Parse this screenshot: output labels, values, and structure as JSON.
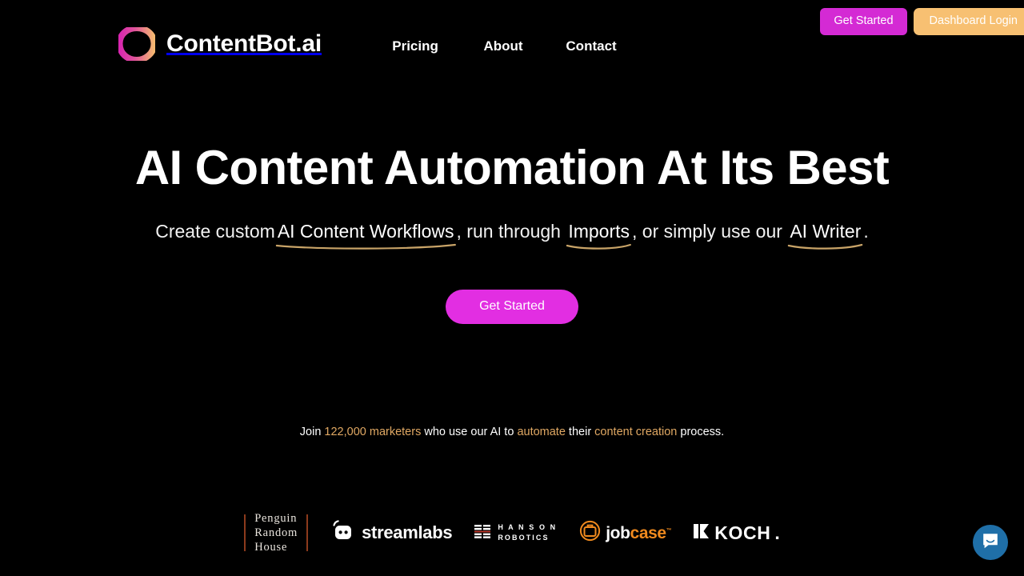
{
  "brand": {
    "name": "ContentBot.ai",
    "logo_icon": "gradient-ring-icon",
    "gradient_from": "#d926b0",
    "gradient_to": "#f5b870"
  },
  "nav": {
    "items": [
      {
        "label": "Pricing"
      },
      {
        "label": "About"
      },
      {
        "label": "Contact"
      }
    ]
  },
  "auth": {
    "get_started_label": "Get Started",
    "dashboard_login_label": "Dashboard Login",
    "get_started_color": "#d42ad4",
    "dashboard_login_color": "#f7c072"
  },
  "hero": {
    "title": "AI Content Automation At Its Best",
    "sub": {
      "part1": "Create custom",
      "hl1": "AI Content Workflows",
      "part2": ", run through ",
      "hl2": "Imports",
      "part3": ", or simply use our ",
      "hl3": "AI Writer",
      "part4": "."
    },
    "cta_label": "Get Started",
    "cta_color": "#e22ee2",
    "underline_color": "#c9a468"
  },
  "social_proof": {
    "part1": "Join ",
    "accent1": "122,000 marketers",
    "part2": " who use our AI to ",
    "accent2": "automate",
    "part3": " their ",
    "accent3": "content creation",
    "part4": " process.",
    "accent_color": "#e0a863"
  },
  "logos": {
    "penguin": {
      "line1": "Penguin",
      "line2": "Random",
      "line3": "House",
      "rule_color": "#8c3a1c"
    },
    "streamlabs": {
      "name": "streamlabs",
      "icon": "streamlabs-mascot-icon"
    },
    "hanson": {
      "line1": "H A N S O N",
      "line2": "ROBOTICS",
      "icon": "hanson-bars-icon"
    },
    "jobcase": {
      "part1": "job",
      "part2": "case",
      "tm": "™",
      "icon": "jobcase-briefcase-icon",
      "color": "#f08a1e"
    },
    "koch": {
      "name": "KOCH",
      "dot": ".",
      "icon": "koch-mark-icon"
    }
  },
  "chat": {
    "label": "Open chat",
    "icon": "chat-bubble-icon",
    "color": "#1f6fa8"
  }
}
